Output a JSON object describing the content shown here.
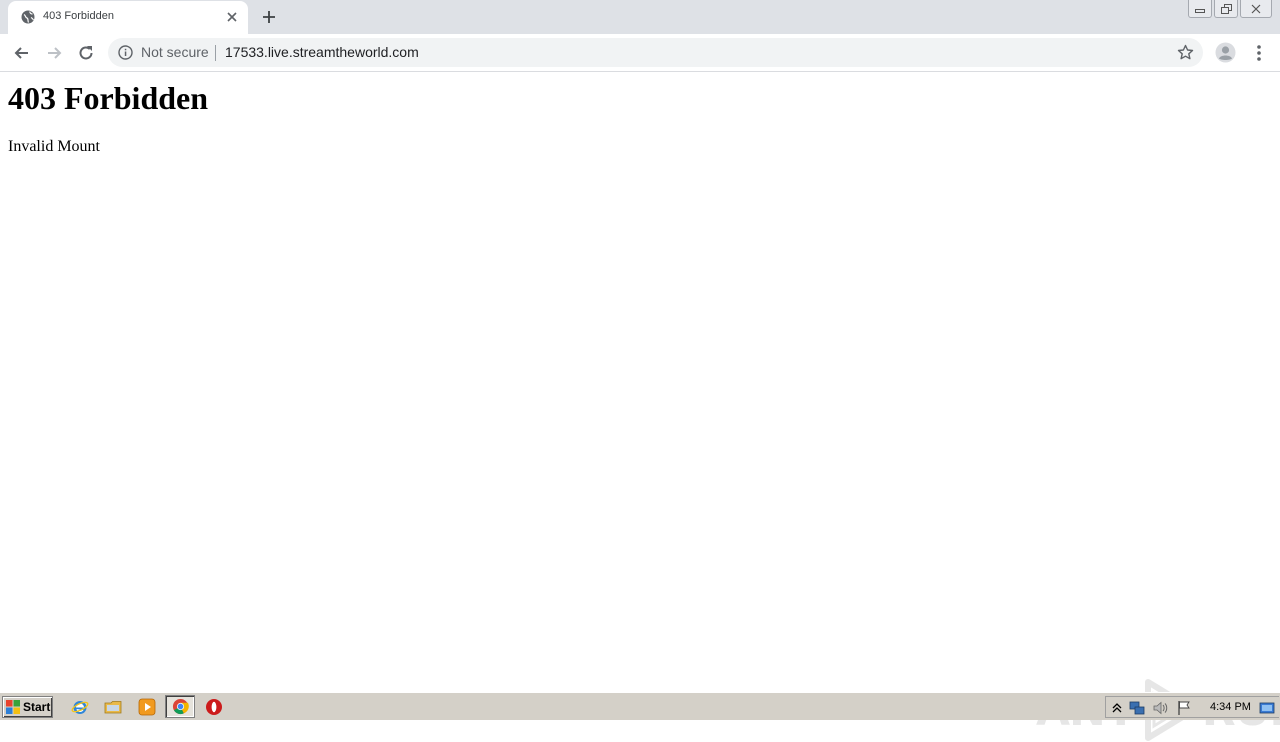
{
  "browser": {
    "tab": {
      "title": "403 Forbidden"
    },
    "omnibox": {
      "security_label": "Not secure",
      "url": "17533.live.streamtheworld.com"
    }
  },
  "page": {
    "heading": "403 Forbidden",
    "message": "Invalid Mount"
  },
  "watermark": {
    "left": "ANY",
    "right": "RUN"
  },
  "taskbar": {
    "start_label": "Start",
    "clock": "4:34 PM"
  },
  "icons": {
    "tab_favicon": "globe-icon",
    "tab_close": "close-icon",
    "new_tab": "plus-icon",
    "back": "arrow-left-icon",
    "forward": "arrow-right-icon",
    "reload": "reload-icon",
    "info": "info-icon",
    "bookmark": "star-icon",
    "profile": "avatar-icon",
    "menu": "kebab-menu-icon"
  },
  "colors": {
    "tabstrip_bg": "#dee1e6",
    "omnibox_bg": "#f1f3f4",
    "taskbar_bg": "#d4d0c8"
  }
}
